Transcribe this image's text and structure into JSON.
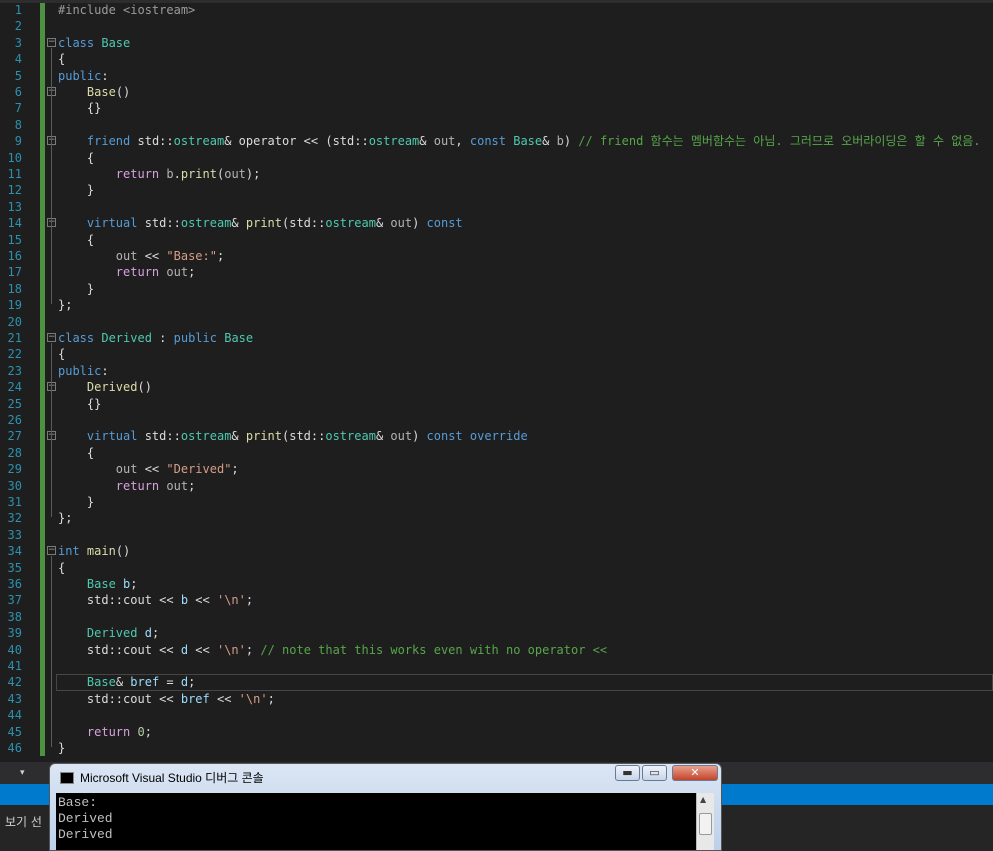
{
  "editor": {
    "lines": [
      {
        "n": "1",
        "code": "<span class='pp'>#include &lt;iostream&gt;</span>"
      },
      {
        "n": "2",
        "code": ""
      },
      {
        "n": "3",
        "code": "<span class='kw'>class</span> <span class='ty'>Base</span>"
      },
      {
        "n": "4",
        "code": "{"
      },
      {
        "n": "5",
        "code": "<span class='kw'>public</span>:"
      },
      {
        "n": "6",
        "code": "    <span class='fn'>Base</span>()"
      },
      {
        "n": "7",
        "code": "    {}"
      },
      {
        "n": "8",
        "code": ""
      },
      {
        "n": "9",
        "code": "    <span class='kw'>friend</span> std::<span class='ty'>ostream</span>&amp; operator &lt;&lt; (std::<span class='ty'>ostream</span>&amp; <span class='op'>out</span>, <span class='kw'>const</span> <span class='ty'>Base</span>&amp; <span class='op'>b</span>) <span class='cm'>// friend 함수는 멤버함수는 아님. 그러므로 오버라이딩은 할 수 없음.</span>"
      },
      {
        "n": "10",
        "code": "    {"
      },
      {
        "n": "11",
        "code": "        <span class='kc'>return</span> <span class='op'>b</span>.<span class='fn'>print</span>(<span class='op'>out</span>);"
      },
      {
        "n": "12",
        "code": "    }"
      },
      {
        "n": "13",
        "code": ""
      },
      {
        "n": "14",
        "code": "    <span class='kw'>virtual</span> std::<span class='ty'>ostream</span>&amp; <span class='fn'>print</span>(std::<span class='ty'>ostream</span>&amp; <span class='op'>out</span>) <span class='kw'>const</span>"
      },
      {
        "n": "15",
        "code": "    {"
      },
      {
        "n": "16",
        "code": "        <span class='op'>out</span> &lt;&lt; <span class='st'>\"Base:\"</span>;"
      },
      {
        "n": "17",
        "code": "        <span class='kc'>return</span> <span class='op'>out</span>;"
      },
      {
        "n": "18",
        "code": "    }"
      },
      {
        "n": "19",
        "code": "};"
      },
      {
        "n": "20",
        "code": ""
      },
      {
        "n": "21",
        "code": "<span class='kw'>class</span> <span class='ty'>Derived</span> : <span class='kw'>public</span> <span class='ty'>Base</span>"
      },
      {
        "n": "22",
        "code": "{"
      },
      {
        "n": "23",
        "code": "<span class='kw'>public</span>:"
      },
      {
        "n": "24",
        "code": "    <span class='fn'>Derived</span>()"
      },
      {
        "n": "25",
        "code": "    {}"
      },
      {
        "n": "26",
        "code": ""
      },
      {
        "n": "27",
        "code": "    <span class='kw'>virtual</span> std::<span class='ty'>ostream</span>&amp; <span class='fn'>print</span>(std::<span class='ty'>ostream</span>&amp; <span class='op'>out</span>) <span class='kw'>const</span> <span class='kw'>override</span>"
      },
      {
        "n": "28",
        "code": "    {"
      },
      {
        "n": "29",
        "code": "        <span class='op'>out</span> &lt;&lt; <span class='st'>\"Derived\"</span>;"
      },
      {
        "n": "30",
        "code": "        <span class='kc'>return</span> <span class='op'>out</span>;"
      },
      {
        "n": "31",
        "code": "    }"
      },
      {
        "n": "32",
        "code": "};"
      },
      {
        "n": "33",
        "code": ""
      },
      {
        "n": "34",
        "code": "<span class='kw'>int</span> <span class='fn'>main</span>()"
      },
      {
        "n": "35",
        "code": "{"
      },
      {
        "n": "36",
        "code": "    <span class='ty'>Base</span> <span class='pr'>b</span>;"
      },
      {
        "n": "37",
        "code": "    std::<span class='pl'>cout</span> &lt;&lt; <span class='pr'>b</span> &lt;&lt; <span class='ch'>'\\n'</span>;"
      },
      {
        "n": "38",
        "code": ""
      },
      {
        "n": "39",
        "code": "    <span class='ty'>Derived</span> <span class='pr'>d</span>;"
      },
      {
        "n": "40",
        "code": "    std::<span class='pl'>cout</span> &lt;&lt; <span class='pr'>d</span> &lt;&lt; <span class='ch'>'\\n'</span>; <span class='cm'>// note that this works even with no operator &lt;&lt;</span>"
      },
      {
        "n": "41",
        "code": ""
      },
      {
        "n": "42",
        "code": "    <span class='ty'>Base</span>&amp; <span class='pr'>bref</span> = <span class='pr'>d</span>;"
      },
      {
        "n": "43",
        "code": "    std::<span class='pl'>cout</span> &lt;&lt; <span class='pr'>bref</span> &lt;&lt; <span class='ch'>'\\n'</span>;"
      },
      {
        "n": "44",
        "code": ""
      },
      {
        "n": "45",
        "code": "    <span class='kc'>return</span> <span class='nm'>0</span>;"
      },
      {
        "n": "46",
        "code": "}"
      }
    ],
    "fold_lines": [
      3,
      6,
      9,
      14,
      21,
      24,
      27,
      34
    ],
    "current_line": 42
  },
  "console": {
    "title": "Microsoft Visual Studio 디버그 콘솔",
    "output": [
      "Base:",
      "Derived",
      "Derived"
    ],
    "minimize_glyph": "▬",
    "maximize_glyph": "▭",
    "close_glyph": "✕"
  },
  "bottom_panel": {
    "label": "보기 선"
  },
  "dropdown_glyph": "▾",
  "fold_glyph": "−",
  "scroll_up_glyph": "▲",
  "colors": {
    "background": "#1e1e1e",
    "line_number": "#2b91af",
    "keyword": "#569cd6",
    "type": "#4ec9b0",
    "comment": "#57a64a",
    "string": "#d69d85",
    "status_bar": "#007acc"
  }
}
